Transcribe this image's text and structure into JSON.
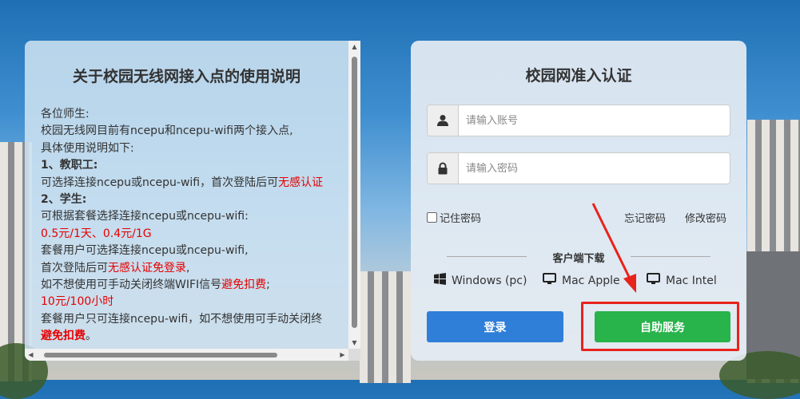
{
  "notice": {
    "title": "关于校园无线网接入点的使用说明",
    "lines": [
      {
        "text": "各位师生:"
      },
      {
        "text": "校园无线网目前有ncepu和ncepu-wifi两个接入点,"
      },
      {
        "text": "具体使用说明如下:"
      },
      {
        "text": "1、教职工:"
      },
      {
        "pre": "可选择连接ncepu或ncepu-wifi，首次登陆后可",
        "red": "无感认证"
      },
      {
        "text": "2、学生:"
      },
      {
        "text": "可根据套餐选择连接ncepu或ncepu-wifi:"
      },
      {
        "red": "0.5元/1天、0.4元/1G"
      },
      {
        "text": "套餐用户可选择连接ncepu或ncepu-wifi,"
      },
      {
        "pre": "首次登陆后可",
        "red": "无感认证免登录",
        "post": ","
      },
      {
        "pre": "如不想使用可手动关闭终端WIFI信号",
        "red": "避免扣费",
        "post": ";"
      },
      {
        "red": "10元/100小时"
      },
      {
        "text": "套餐用户只可连接ncepu-wifi，如不想使用可手动关闭终"
      },
      {
        "red": "避免扣费",
        "post": "。"
      }
    ]
  },
  "login": {
    "title": "校园网准入认证",
    "account_placeholder": "请输入账号",
    "password_placeholder": "请输入密码",
    "remember_label": "记住密码",
    "forgot_label": "忘记密码",
    "change_label": "修改密码",
    "download_title": "客户端下载",
    "downloads": [
      {
        "label": "Windows (pc)",
        "icon": "windows-icon"
      },
      {
        "label": "Mac Apple",
        "icon": "monitor-icon"
      },
      {
        "label": "Mac Intel",
        "icon": "monitor-icon"
      }
    ],
    "login_button": "登录",
    "self_service_button": "自助服务"
  },
  "colors": {
    "primary": "#2f7ed8",
    "success": "#28b34b",
    "highlight": "#e8231c",
    "warning_text": "#e60000"
  }
}
